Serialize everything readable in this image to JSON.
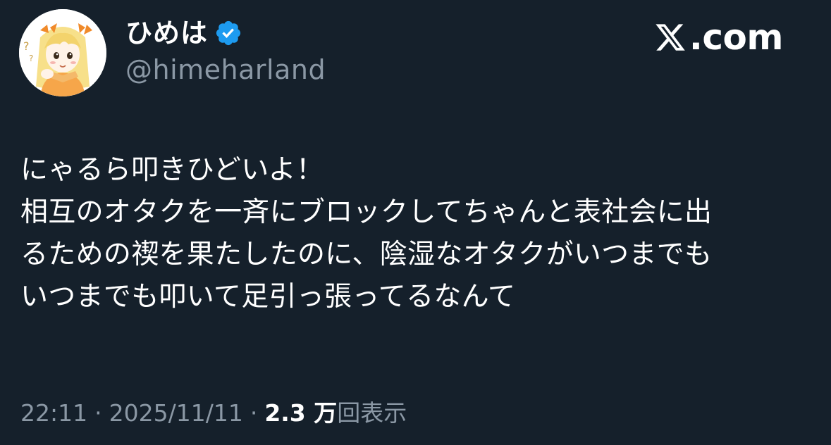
{
  "author": {
    "display_name": "ひめは",
    "handle": "@himeharland",
    "verified": true,
    "verified_color": "#1d9bf0",
    "avatar_icon": "anime-girl-avatar-icon"
  },
  "brand": {
    "icon": "x-logo-icon",
    "text": ".com"
  },
  "tweet": {
    "lines": [
      "にゃるら叩きひどいよ！",
      "相互のオタクを一斉にブロックしてちゃんと表社会に出",
      "るための禊を果たしたのに、陰湿なオタクがいつまでも",
      "いつまでも叩いて足引っ張ってるなんて"
    ]
  },
  "meta": {
    "time": "22:11",
    "separator": "·",
    "date": "2025/11/11",
    "views_count": "2.3 万",
    "views_label": "回表示"
  },
  "colors": {
    "background": "#15202b",
    "text_primary": "#ffffff",
    "text_secondary": "#8b98a5",
    "accent": "#1d9bf0"
  }
}
